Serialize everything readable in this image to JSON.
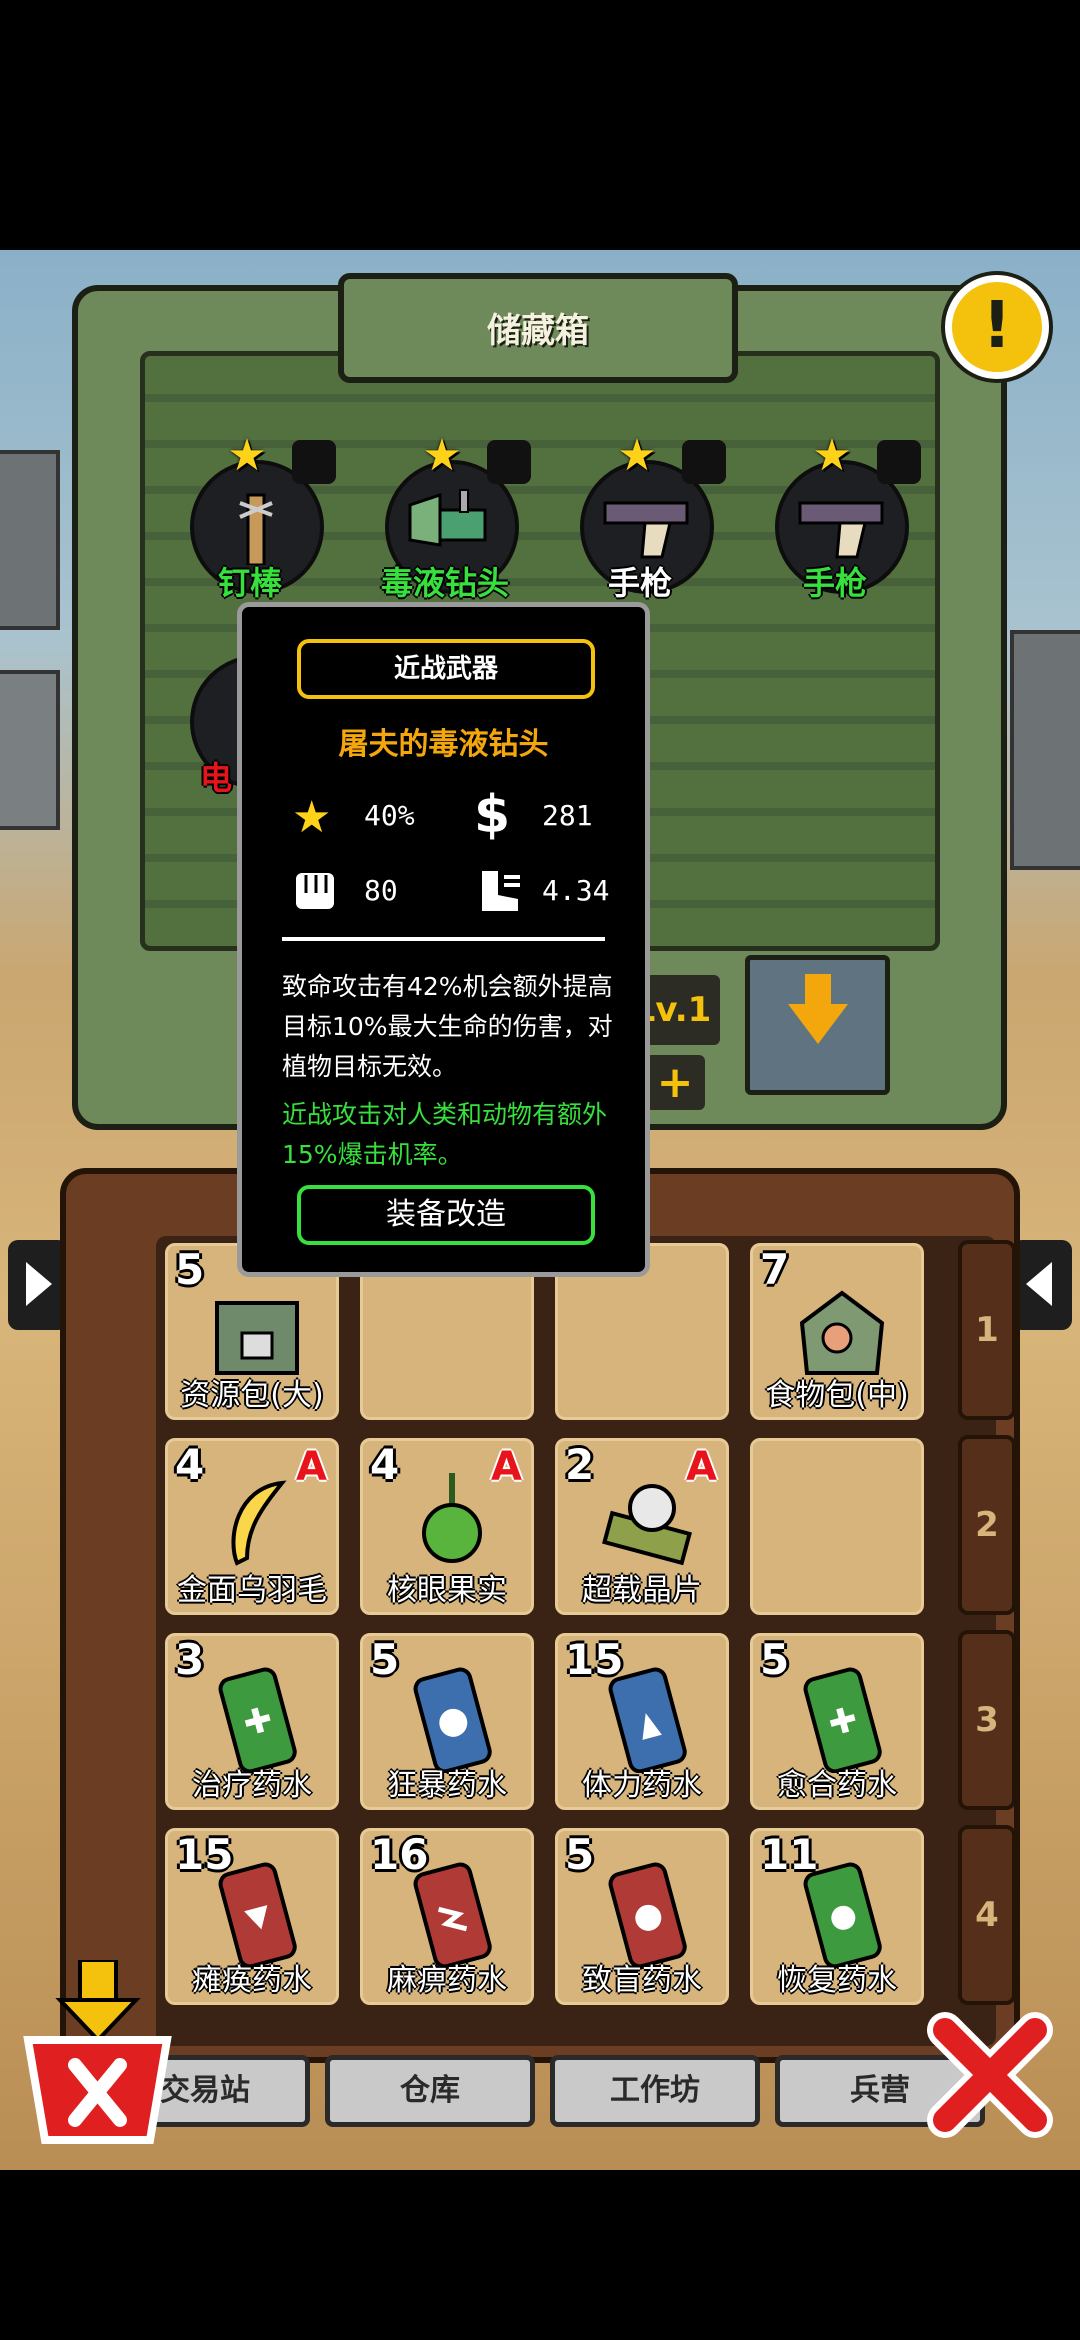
{
  "storage": {
    "title": "储藏箱",
    "level": "Lv.1"
  },
  "weapons": [
    {
      "name": "钉棒",
      "icon": "spiked-club-icon",
      "star": true
    },
    {
      "name": "毒液钻头",
      "icon": "venom-drill-icon",
      "star": true
    },
    {
      "name": "手枪",
      "icon": "pistol-icon",
      "star": true
    },
    {
      "name": "手枪",
      "icon": "pistol-icon",
      "star": true
    },
    {
      "name": "电",
      "icon": "electric-weapon-icon",
      "star": false
    }
  ],
  "tooltip": {
    "category": "近战武器",
    "name": "屠夫的毒液钻头",
    "crit": "40%",
    "price": "281",
    "damage": "80",
    "speed": "4.34",
    "description": "致命攻击有42%机会额外提高目标10%最大生命的伤害，对植物目标无效。",
    "bonus": "近战攻击对人类和动物有额外15%爆击机率。",
    "modify_label": "装备改造"
  },
  "inventory": [
    {
      "name": "资源包(大)",
      "count": "5",
      "rank": ""
    },
    {
      "name": "",
      "count": "",
      "rank": ""
    },
    {
      "name": "",
      "count": "",
      "rank": ""
    },
    {
      "name": "食物包(中)",
      "count": "7",
      "rank": ""
    },
    {
      "name": "金面乌羽毛",
      "count": "4",
      "rank": "A"
    },
    {
      "name": "核眼果实",
      "count": "4",
      "rank": "A"
    },
    {
      "name": "超载晶片",
      "count": "2",
      "rank": "A"
    },
    {
      "name": "",
      "count": "",
      "rank": ""
    },
    {
      "name": "治疗药水",
      "count": "3",
      "rank": ""
    },
    {
      "name": "狂暴药水",
      "count": "5",
      "rank": ""
    },
    {
      "name": "体力药水",
      "count": "15",
      "rank": ""
    },
    {
      "name": "愈合药水",
      "count": "5",
      "rank": ""
    },
    {
      "name": "瘫痪药水",
      "count": "15",
      "rank": ""
    },
    {
      "name": "麻痹药水",
      "count": "16",
      "rank": ""
    },
    {
      "name": "致盲药水",
      "count": "5",
      "rank": ""
    },
    {
      "name": "恢复药水",
      "count": "11",
      "rank": ""
    }
  ],
  "row_tabs": [
    "1",
    "2",
    "3",
    "4"
  ],
  "bottom_tabs": [
    "交易站",
    "仓库",
    "工作坊",
    "兵营"
  ],
  "colors": {
    "accent_gold": "#f4c20d",
    "green_text": "#37e03c",
    "red_text": "#e8141c",
    "item_name_orange": "#f4a70d"
  }
}
